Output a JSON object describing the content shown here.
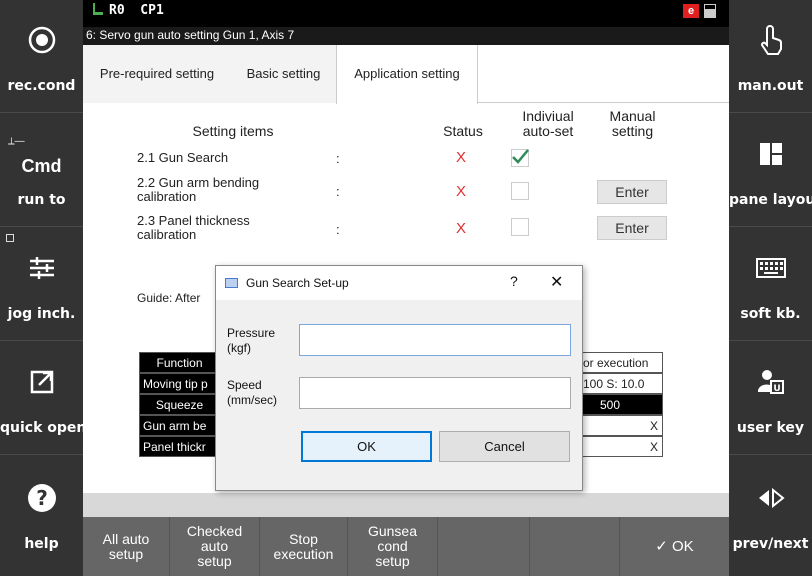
{
  "statusbar": {
    "text": "R0  CP1",
    "badge": "e"
  },
  "subtitle": "6: Servo gun auto setting Gun 1, Axis 7",
  "tabs": [
    "Pre-required setting",
    "Basic setting",
    "Application setting"
  ],
  "headers": {
    "items": "Setting items",
    "status": "Status",
    "autoset": "Indiviual\nauto-set",
    "manual": "Manual\nsetting"
  },
  "rows": [
    {
      "name": "2.1 Gun Search",
      "colon": ":",
      "status": "X",
      "checked": true
    },
    {
      "name": "2.2 Gun arm bending\ncalibration",
      "colon": ":",
      "status": "X",
      "checked": false,
      "manual": "Enter"
    },
    {
      "name": "2.3 Panel thickness\ncalibration",
      "colon": ":",
      "status": "X",
      "checked": false,
      "manual": "Enter"
    }
  ],
  "guide": "Guide: After",
  "table": {
    "left": [
      "Function",
      "Moving tip p",
      "Squeeze",
      "Gun arm be",
      "Panel thickr"
    ],
    "right": [
      "or execution",
      "100  S: 10.0",
      "500",
      "X",
      "X"
    ]
  },
  "dialog": {
    "title": "Gun Search Set-up",
    "help": "?",
    "close": "✕",
    "pressure_label": "Pressure\n(kgf)",
    "pressure_value": "",
    "speed_label": "Speed\n(mm/sec)",
    "speed_value": "",
    "ok": "OK",
    "cancel": "Cancel"
  },
  "bottom": {
    "b1": "All auto\nsetup",
    "b2": "Checked\nauto\nsetup",
    "b3": "Stop\nexecution",
    "b4": "Gunsea\ncond\nsetup",
    "ok": "✓ OK"
  },
  "left_buttons": {
    "rec": "rec.cond",
    "cmd": "Cmd",
    "runto": "run to",
    "jog": "jog inch.",
    "quick": "quick open",
    "help": "help"
  },
  "right_buttons": {
    "manout": "man.out",
    "pane": "pane layout",
    "softkb": "soft kb.",
    "userkey": "user key",
    "prevnext": "prev/next"
  },
  "colors": {
    "accent": "#0078d7",
    "status_x": "#e03030",
    "check": "#2e8b57"
  }
}
